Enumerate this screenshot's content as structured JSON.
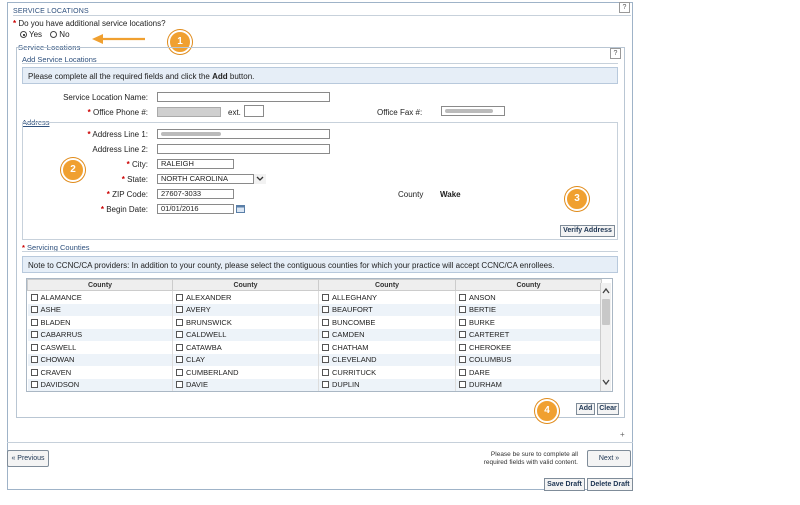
{
  "section": {
    "title": "Service Locations",
    "question": "Do you have additional service locations?",
    "yes_label": "Yes",
    "no_label": "No",
    "help": "?"
  },
  "service_locations": {
    "title": "Service Locations",
    "tab": "Add Service Locations",
    "help": "?",
    "instruction_pre": "Please complete all the required fields and click the ",
    "instruction_bold": "Add",
    "instruction_post": " button."
  },
  "form": {
    "name_label": "Service Location Name:",
    "name_value": "",
    "phone_label": "Office Phone #:",
    "ext_label": "ext.",
    "fax_label": "Office Fax #:",
    "address_link": "Address",
    "addr1_label": "Address Line 1:",
    "addr2_label": "Address Line 2:",
    "addr2_value": "",
    "city_label": "City:",
    "city_value": "RALEIGH",
    "state_label": "State:",
    "state_value": "NORTH CAROLINA",
    "zip_label": "ZIP Code:",
    "zip_value": "27607-3033",
    "county_label": "County",
    "county_value": "Wake",
    "begin_label": "Begin Date:",
    "begin_value": "01/01/2016",
    "verify_label": "Verify Address"
  },
  "counties": {
    "title": "Servicing Counties",
    "note": "Note to CCNC/CA providers: In addition to your county, please select the contiguous counties for which your practice will accept CCNC/CA enrollees.",
    "column_header": "County",
    "rows": [
      [
        "ALAMANCE",
        "ALEXANDER",
        "ALLEGHANY",
        "ANSON"
      ],
      [
        "ASHE",
        "AVERY",
        "BEAUFORT",
        "BERTIE"
      ],
      [
        "BLADEN",
        "BRUNSWICK",
        "BUNCOMBE",
        "BURKE"
      ],
      [
        "CABARRUS",
        "CALDWELL",
        "CAMDEN",
        "CARTERET"
      ],
      [
        "CASWELL",
        "CATAWBA",
        "CHATHAM",
        "CHEROKEE"
      ],
      [
        "CHOWAN",
        "CLAY",
        "CLEVELAND",
        "COLUMBUS"
      ],
      [
        "CRAVEN",
        "CUMBERLAND",
        "CURRITUCK",
        "DARE"
      ],
      [
        "DAVIDSON",
        "DAVIE",
        "DUPLIN",
        "DURHAM"
      ]
    ]
  },
  "actions": {
    "add": "Add",
    "clear": "Clear",
    "plus": "+",
    "previous": "« Previous",
    "next": "Next »",
    "notice_line1": "Please be sure to complete all",
    "notice_line2": "required fields with valid content.",
    "save_draft": "Save Draft",
    "delete_draft": "Delete Draft"
  },
  "callouts": [
    "1",
    "2",
    "3",
    "4"
  ],
  "colors": {
    "callout": "#f0a030",
    "arrow": "#f0a030",
    "required": "#cc0000",
    "heading": "#2d4f7c"
  }
}
